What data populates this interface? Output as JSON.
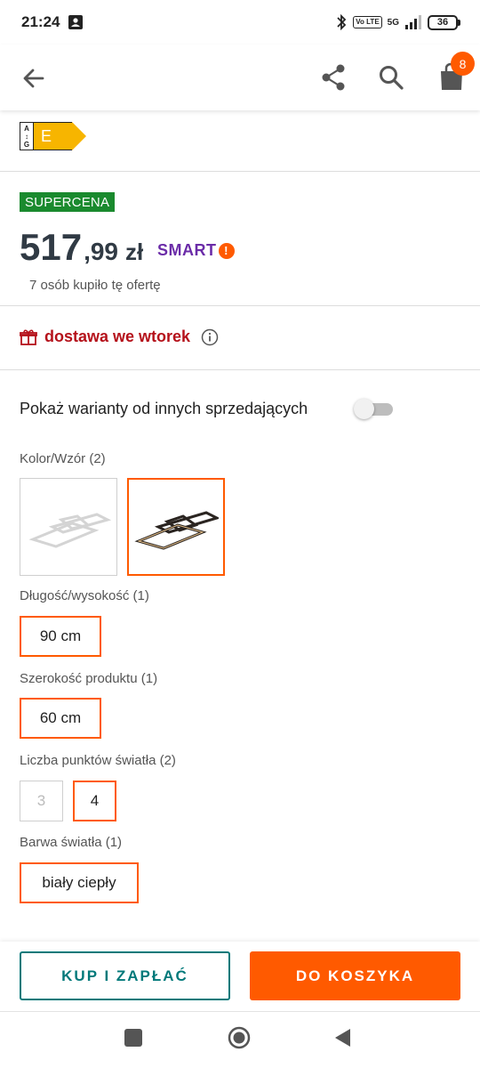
{
  "status_bar": {
    "time": "21:24",
    "network": "5G",
    "volte": "Vo LTE",
    "battery": "36"
  },
  "app_bar": {
    "cart_count": "8",
    "icons": [
      "back-arrow-icon",
      "share-icon",
      "search-icon",
      "cart-icon"
    ]
  },
  "energy_label": {
    "scale_top": "A",
    "scale_bottom": "G",
    "class": "E",
    "color": "#f7b500"
  },
  "price_block": {
    "badge": "SUPERCENA",
    "price_integer": "517",
    "price_decimal": ",99",
    "currency": "zł",
    "smart_label": "SMART",
    "smart_mark": "!",
    "bought_text": "7 osób kupiło tę ofertę"
  },
  "delivery": {
    "text": "dostawa we wtorek"
  },
  "variants": {
    "toggle_label": "Pokaż warianty od innych sprzedających",
    "toggle_on": false,
    "groups": {
      "color": {
        "label": "Kolor/Wzór (2)"
      },
      "length": {
        "label": "Długość/wysokość (1)",
        "options": [
          "90 cm"
        ]
      },
      "width": {
        "label": "Szerokość produktu (1)",
        "options": [
          "60 cm"
        ]
      },
      "points": {
        "label": "Liczba punktów światła (2)",
        "options": [
          "3",
          "4"
        ],
        "selected": "4"
      },
      "light": {
        "label": "Barwa światła (1)",
        "options": [
          "biały ciepły"
        ]
      }
    }
  },
  "actions": {
    "buy_now": "KUP I ZAPŁAĆ",
    "add_to_cart": "DO KOSZYKA"
  },
  "colors": {
    "accent": "#ff5a00",
    "teal": "#00797a",
    "green_badge": "#1a8a2e",
    "delivery_red": "#b5121b",
    "smart_purple": "#6b2ca8"
  }
}
